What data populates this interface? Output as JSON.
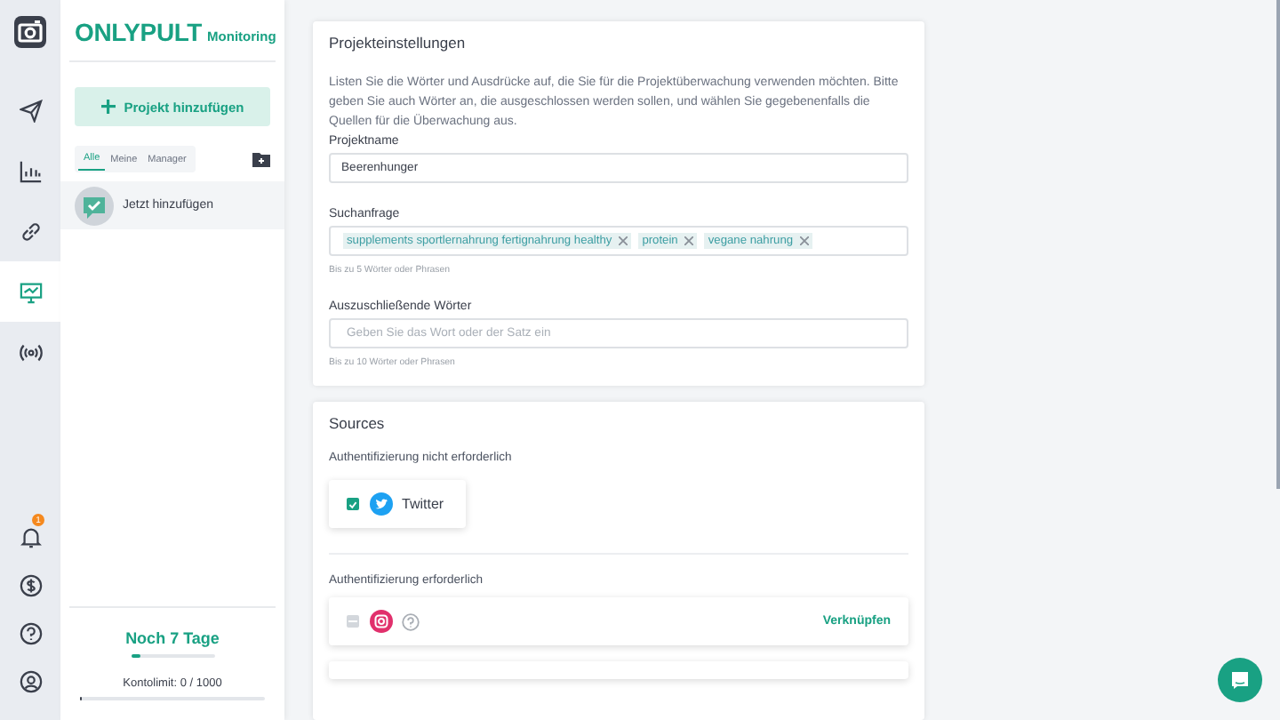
{
  "nav": {
    "items": [
      {
        "kind": "send",
        "selected": false
      },
      {
        "kind": "chart",
        "selected": false
      },
      {
        "kind": "link",
        "selected": false
      },
      {
        "kind": "monitor",
        "selected": true
      },
      {
        "kind": "radio",
        "selected": false
      }
    ],
    "bottom": [
      {
        "kind": "bell",
        "badge": "1"
      },
      {
        "kind": "dollar"
      },
      {
        "kind": "help"
      },
      {
        "kind": "user"
      }
    ]
  },
  "sidebar": {
    "brand": "ONLYPULT",
    "product": "Monitoring",
    "add_button": "Projekt hinzufügen",
    "filters": [
      {
        "label": "Alle",
        "selected": true
      },
      {
        "label": "Meine",
        "selected": false
      },
      {
        "label": "Manager",
        "selected": false
      }
    ],
    "projects": [
      {
        "label": "Jetzt hinzufügen",
        "selected": true
      }
    ],
    "trial": {
      "label": "Noch 7 Tage",
      "level": 0.12
    },
    "limit": {
      "label": "Kontolimit: 0 / 1000",
      "level": 0.01
    }
  },
  "settings": {
    "title": "Projekteinstellungen",
    "intro": "Listen Sie die Wörter und Ausdrücke auf, die Sie für die Projektüberwachung verwenden möchten. Bitte geben Sie auch Wörter an, die ausgeschlossen werden sollen, und wählen Sie gegebenenfalls die Quellen für die Überwachung aus.",
    "name_label": "Projektname",
    "name_value": "Beerenhunger",
    "query_label": "Suchanfrage",
    "query_tags": [
      "supplements sportlernahrung fertignahrung healthy",
      "protein",
      "vegane nahrung"
    ],
    "query_hint": "Bis zu 5 Wörter oder Phrasen",
    "exclude_label": "Auszuschließende Wörter",
    "exclude_placeholder": "Geben Sie das Wort oder der Satz ein",
    "exclude_hint": "Bis zu 10 Wörter oder Phrasen"
  },
  "sources": {
    "title": "Sources",
    "groups": [
      {
        "label": "Authentifizierung nicht erforderlich",
        "items": [
          {
            "kind": "twitter",
            "name": "Twitter",
            "checked": true,
            "disabled": false
          }
        ]
      },
      {
        "label": "Authentifizierung erforderlich",
        "items": [
          {
            "kind": "instagram",
            "checked": false,
            "disabled": true,
            "action": "Verknüpfen"
          }
        ]
      }
    ]
  }
}
